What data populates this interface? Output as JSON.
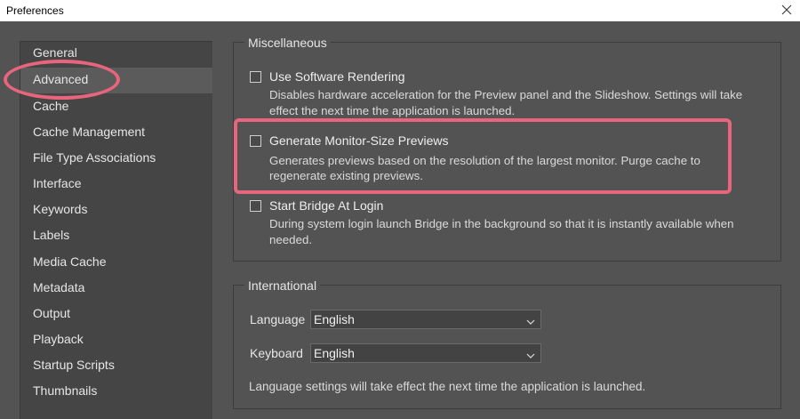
{
  "window": {
    "title": "Preferences"
  },
  "sidebar": {
    "items": [
      {
        "label": "General"
      },
      {
        "label": "Advanced"
      },
      {
        "label": "Cache"
      },
      {
        "label": "Cache Management"
      },
      {
        "label": "File Type Associations"
      },
      {
        "label": "Interface"
      },
      {
        "label": "Keywords"
      },
      {
        "label": "Labels"
      },
      {
        "label": "Media Cache"
      },
      {
        "label": "Metadata"
      },
      {
        "label": "Output"
      },
      {
        "label": "Playback"
      },
      {
        "label": "Startup Scripts"
      },
      {
        "label": "Thumbnails"
      }
    ],
    "selected": "Advanced"
  },
  "misc": {
    "title": "Miscellaneous",
    "options": [
      {
        "label": "Use Software Rendering",
        "checked": false,
        "desc1": "Disables hardware acceleration for the Preview panel and the Slideshow. Settings will take",
        "desc2": "effect the next time the application is launched."
      },
      {
        "label": "Generate Monitor-Size Previews",
        "checked": false,
        "desc1": "Generates previews based on the resolution of the largest monitor. Purge cache to",
        "desc2": "regenerate existing previews."
      },
      {
        "label": "Start Bridge At Login",
        "checked": false,
        "desc1": "During system login launch Bridge in the background so that it is instantly available when",
        "desc2": "needed."
      }
    ]
  },
  "international": {
    "title": "International",
    "language_label": "Language",
    "language_value": "English",
    "keyboard_label": "Keyboard",
    "keyboard_value": "English",
    "note": "Language settings will take effect the next time the application is launched."
  },
  "colors": {
    "annotation": "#e8657d",
    "background": "#535353",
    "sidebar": "#454545"
  }
}
